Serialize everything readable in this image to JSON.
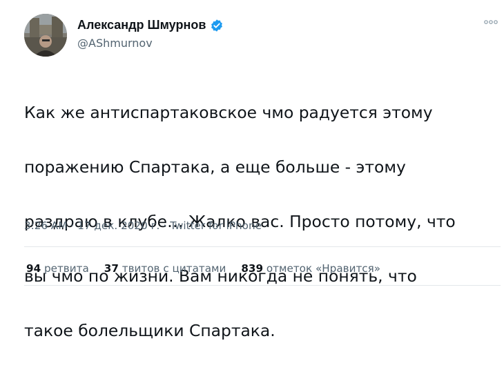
{
  "author": {
    "display_name": "Александр Шмурнов",
    "handle": "@AShmurnov",
    "avatar_icon": "avatar-photo",
    "verified_icon": "verified-badge-icon"
  },
  "tweet": {
    "text_lines": [
      "Как же антиспартаковское чмо радуется этому",
      "поражению Спартака, а еще больше - этому",
      "раздраю в клубе… Жалко вас. Просто потому, что",
      "вы чмо по жизни. Вам никогда не понять, что",
      "такое болельщики Спартака."
    ],
    "time": "3:26 AM",
    "date": "17 дек. 2020 г.",
    "separator": "·",
    "source": "Twitter for iPhone"
  },
  "stats": {
    "retweets_count": "94",
    "retweets_label": "ретвита",
    "quotes_count": "37",
    "quotes_label": "твитов с цитатами",
    "likes_count": "839",
    "likes_label": "отметок «Нравится»"
  },
  "colors": {
    "text": "#0f1419",
    "secondary": "#536471",
    "verified": "#1d9bf0",
    "divider": "#e3e7ea"
  }
}
